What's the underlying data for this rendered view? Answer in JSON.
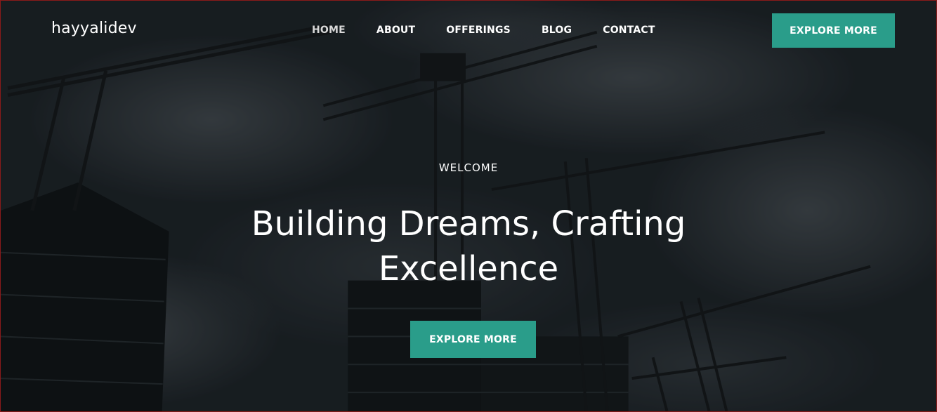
{
  "brand": {
    "logo": "hayyalidev"
  },
  "nav": {
    "items": [
      {
        "label": "HOME",
        "active": true
      },
      {
        "label": "ABOUT",
        "active": false
      },
      {
        "label": "OFFERINGS",
        "active": false
      },
      {
        "label": "BLOG",
        "active": false
      },
      {
        "label": "CONTACT",
        "active": false
      }
    ]
  },
  "header": {
    "cta_label": "EXPLORE MORE"
  },
  "hero": {
    "eyebrow": "WELCOME",
    "headline_line1": "Building Dreams, Crafting",
    "headline_line2": "Excellence",
    "cta_label": "EXPLORE MORE"
  },
  "colors": {
    "accent": "#2a9d8a",
    "text": "#ffffff",
    "frame_border": "#8b1a1a"
  }
}
